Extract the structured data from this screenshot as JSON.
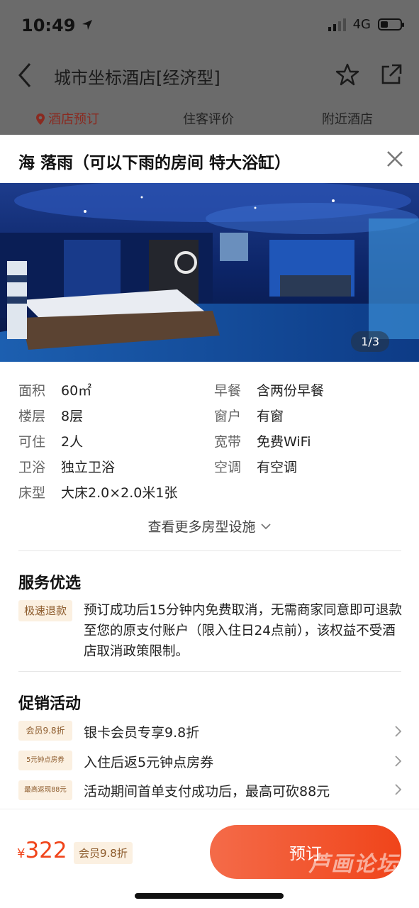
{
  "status_bar": {
    "time": "10:49",
    "network": "4G"
  },
  "nav": {
    "title": "城市坐标酒店[经济型]"
  },
  "bg_tabs": [
    "酒店预订",
    "住客评价",
    "附近酒店"
  ],
  "room": {
    "title": "海 落雨（可以下雨的房间 特大浴缸）",
    "photo_counter": "1/3"
  },
  "facilities": {
    "left": [
      {
        "label": "面积",
        "value": "60㎡"
      },
      {
        "label": "楼层",
        "value": "8层"
      },
      {
        "label": "可住",
        "value": "2人"
      },
      {
        "label": "卫浴",
        "value": "独立卫浴"
      },
      {
        "label": "床型",
        "value": "大床2.0×2.0米1张"
      }
    ],
    "right": [
      {
        "label": "早餐",
        "value": "含两份早餐"
      },
      {
        "label": "窗户",
        "value": "有窗"
      },
      {
        "label": "宽带",
        "value": "免费WiFi"
      },
      {
        "label": "空调",
        "value": "有空调"
      }
    ],
    "more_label": "查看更多房型设施"
  },
  "service": {
    "title": "服务优选",
    "tag": "极速退款",
    "text": "预订成功后15分钟内免费取消，无需商家同意即可退款至您的原支付账户（限入住日24点前），该权益不受酒店取消政策限制。"
  },
  "promo": {
    "title": "促销活动",
    "items": [
      {
        "tag": "会员9.8折",
        "text": "银卡会员专享9.8折"
      },
      {
        "tag": "5元钟点房券",
        "text": "入住后返5元钟点房券"
      },
      {
        "tag": "最高返现88元",
        "text": "活动期间首单支付成功后，最高可砍88元"
      }
    ]
  },
  "bottom": {
    "currency": "¥",
    "price": "322",
    "badge": "会员9.8折",
    "book_label": "预订",
    "watermark": "芦画论坛"
  },
  "colors": {
    "accent": "#f0441a",
    "tag_bg": "#fbf0e1",
    "tag_text": "#8c5a2b"
  }
}
